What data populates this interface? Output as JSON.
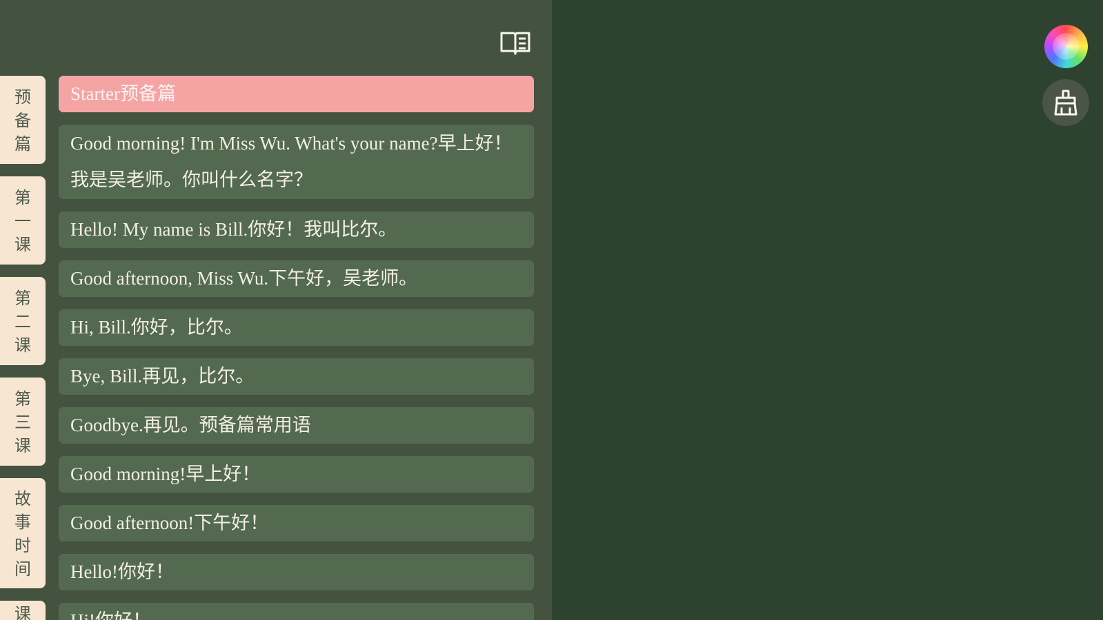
{
  "tabs": [
    {
      "label": "预备篇",
      "chars": [
        "预",
        "备",
        "篇"
      ]
    },
    {
      "label": "第一课",
      "chars": [
        "第",
        "一",
        "课"
      ]
    },
    {
      "label": "第二课",
      "chars": [
        "第",
        "二",
        "课"
      ]
    },
    {
      "label": "第三课",
      "chars": [
        "第",
        "三",
        "课"
      ]
    },
    {
      "label": "故事时间",
      "chars": [
        "故",
        "事",
        "时",
        "间"
      ]
    },
    {
      "label": "课",
      "chars": [
        "课"
      ]
    }
  ],
  "items": [
    {
      "text": "Starter预备篇"
    },
    {
      "text": "Good morning! I'm Miss Wu. What's your name?早上好！我是吴老师。你叫什么名字？"
    },
    {
      "text": "Hello! My name is Bill.你好！我叫比尔。"
    },
    {
      "text": "Good afternoon, Miss Wu.下午好，吴老师。"
    },
    {
      "text": "Hi, Bill.你好，比尔。"
    },
    {
      "text": "Bye, Bill.再见，比尔。"
    },
    {
      "text": "Goodbye.再见。预备篇常用语"
    },
    {
      "text": "Good morning!早上好！"
    },
    {
      "text": "Good afternoon!下午好！"
    },
    {
      "text": "Hello!你好！"
    },
    {
      "text": "Hi!你好！"
    }
  ],
  "icons": {
    "book": "open-book-icon",
    "color": "color-wheel-icon",
    "brush": "brush-icon"
  },
  "colors": {
    "panel": "#44533f",
    "board": "#2e4230",
    "item": "#536a51",
    "selected": "#f5a4a4",
    "tab": "#f7e6d2"
  }
}
